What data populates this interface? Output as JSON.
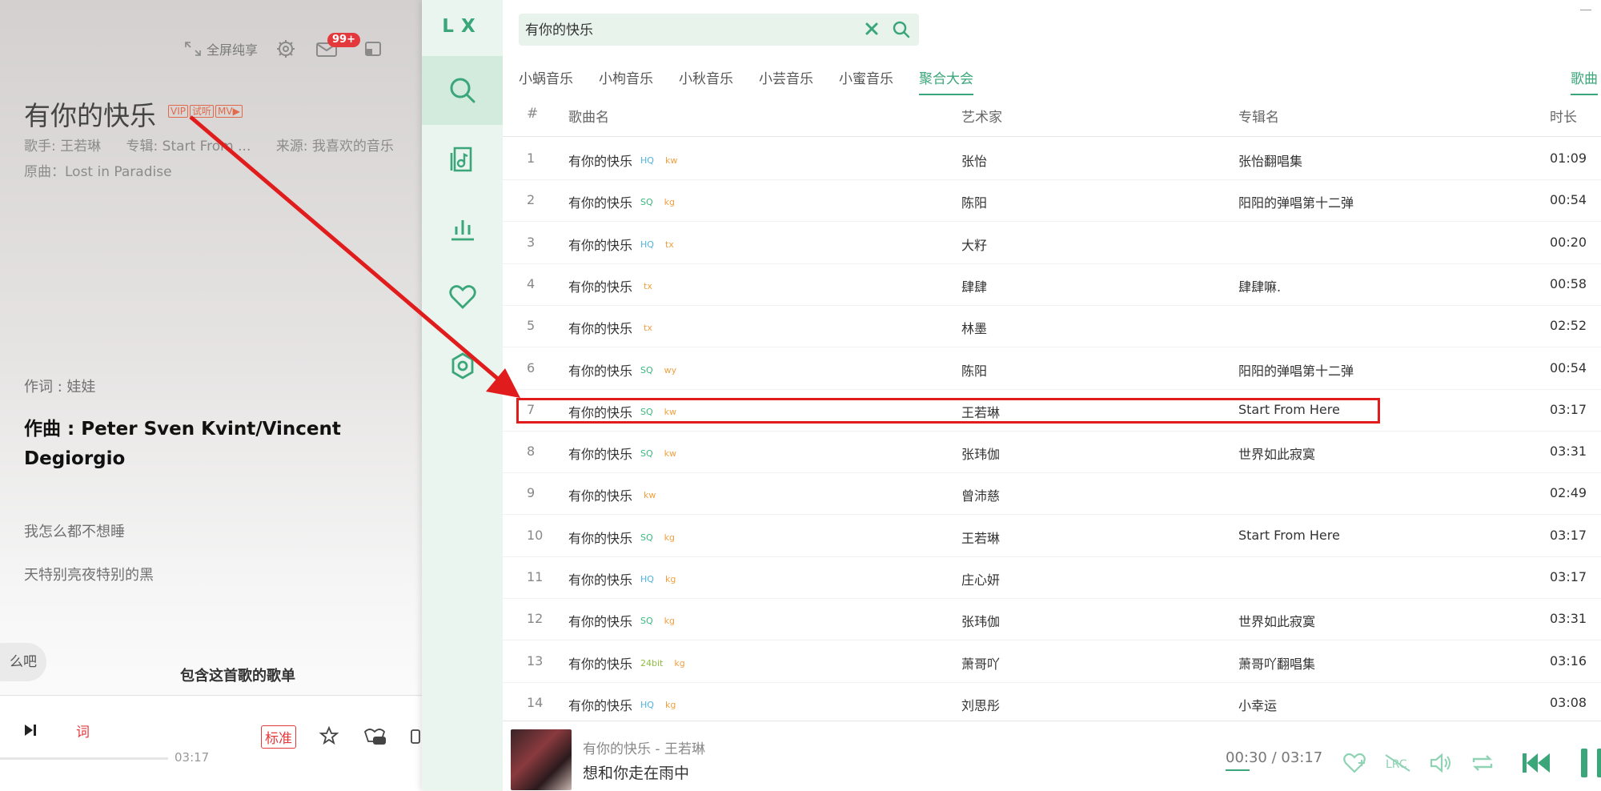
{
  "left_player": {
    "fullscreen_label": "全屏纯享",
    "mail_badge": "99+",
    "song_title": "有你的快乐",
    "tags": [
      "VIP",
      "试听",
      "MV▶"
    ],
    "singer": "歌手: 王若琳",
    "album": "专辑: Start From ...",
    "source": "来源: 我喜欢的音乐",
    "original": "原曲：Lost in Paradise",
    "lyricist": "作词 : 娃娃",
    "composer_line": "作曲 : Peter Sven Kvint/Vincent Degiorgio",
    "lyric_1": "我怎么都不想睡",
    "lyric_2": "天特别亮夜特别的黑",
    "pill_text": "么吧",
    "contains_playlists": "包含这首歌的歌单",
    "lyric_icon_label": "词",
    "quality": "标准",
    "time": "03:17"
  },
  "app": {
    "logo": "LX",
    "search": {
      "value": "有你的快乐",
      "placeholder": ""
    },
    "source_tabs": [
      "小蜗音乐",
      "小枸音乐",
      "小秋音乐",
      "小芸音乐",
      "小蜜音乐",
      "聚合大会"
    ],
    "active_tab": "聚合大会",
    "right_tab": "歌曲",
    "columns": {
      "num": "#",
      "name": "歌曲名",
      "artist": "艺术家",
      "album": "专辑名",
      "duration": "时长"
    },
    "rows": [
      {
        "num": "1",
        "name": "有你的快乐",
        "quality": "HQ",
        "source": "kw",
        "artist": "张怡",
        "album": "张怡翻唱集",
        "duration": "01:09"
      },
      {
        "num": "2",
        "name": "有你的快乐",
        "quality": "SQ",
        "source": "kg",
        "artist": "陈阳",
        "album": "阳阳的弹唱第十二弹",
        "duration": "00:54"
      },
      {
        "num": "3",
        "name": "有你的快乐",
        "quality": "HQ",
        "source": "tx",
        "artist": "大籽",
        "album": "",
        "duration": "00:20"
      },
      {
        "num": "4",
        "name": "有你的快乐",
        "quality": "",
        "source": "tx",
        "artist": "肆肆",
        "album": "肆肆嘛.",
        "duration": "00:58"
      },
      {
        "num": "5",
        "name": "有你的快乐",
        "quality": "",
        "source": "tx",
        "artist": "林墨",
        "album": "",
        "duration": "02:52"
      },
      {
        "num": "6",
        "name": "有你的快乐",
        "quality": "SQ",
        "source": "wy",
        "artist": "陈阳",
        "album": "阳阳的弹唱第十二弹",
        "duration": "00:54"
      },
      {
        "num": "7",
        "name": "有你的快乐",
        "quality": "SQ",
        "source": "kw",
        "artist": "王若琳",
        "album": "Start From Here",
        "duration": "03:17"
      },
      {
        "num": "8",
        "name": "有你的快乐",
        "quality": "SQ",
        "source": "kw",
        "artist": "张玮伽",
        "album": "世界如此寂寞",
        "duration": "03:31"
      },
      {
        "num": "9",
        "name": "有你的快乐",
        "quality": "",
        "source": "kw",
        "artist": "曾沛慈",
        "album": "",
        "duration": "02:49"
      },
      {
        "num": "10",
        "name": "有你的快乐",
        "quality": "SQ",
        "source": "kg",
        "artist": "王若琳",
        "album": "Start From Here",
        "duration": "03:17"
      },
      {
        "num": "11",
        "name": "有你的快乐",
        "quality": "HQ",
        "source": "kg",
        "artist": "庄心妍",
        "album": "",
        "duration": "03:17"
      },
      {
        "num": "12",
        "name": "有你的快乐",
        "quality": "SQ",
        "source": "kg",
        "artist": "张玮伽",
        "album": "世界如此寂寞",
        "duration": "03:31"
      },
      {
        "num": "13",
        "name": "有你的快乐",
        "quality": "24bit",
        "source": "kg",
        "artist": "萧哥吖",
        "album": "萧哥吖翻唱集",
        "duration": "03:16"
      },
      {
        "num": "14",
        "name": "有你的快乐",
        "quality": "HQ",
        "source": "kg",
        "artist": "刘思彤",
        "album": "小幸运",
        "duration": "03:08"
      }
    ],
    "player": {
      "title": "有你的快乐 - 王若琳",
      "lyric": "想和你走在雨中",
      "time": "00:30 / 03:17"
    },
    "colors": {
      "accent": "#3aa67a",
      "annotation": "#e11c1c"
    }
  }
}
